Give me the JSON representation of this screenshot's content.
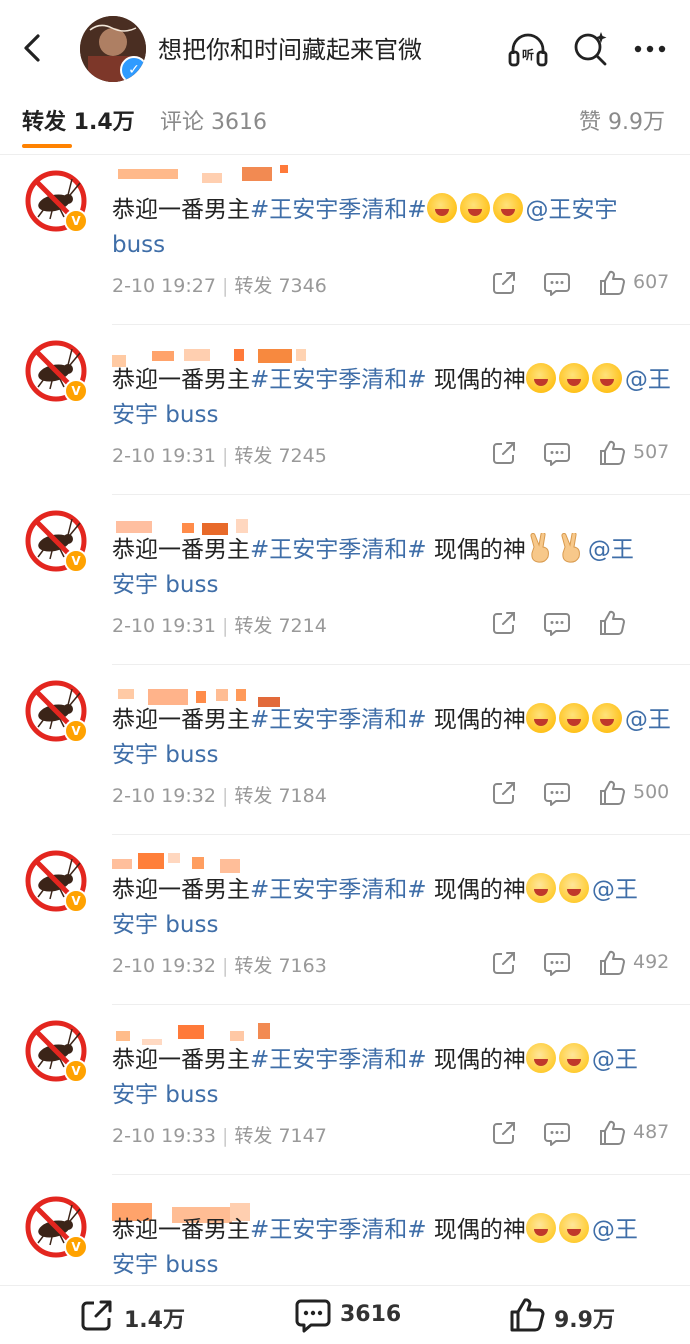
{
  "header": {
    "account_name": "想把你和时间藏起来官微"
  },
  "tabs": {
    "repost": "转发 1.4万",
    "comment": "评论 3616",
    "like": "赞 9.9万"
  },
  "reposts": [
    {
      "tag": "#王安宇季清和#",
      "prefix": "恭迎一番男主",
      "after": "",
      "emoji": [
        "cry-smile",
        "cry-smile",
        "cry-smile"
      ],
      "mention": "@王安宇",
      "mention2": "buss",
      "time": "2-10 19:27",
      "repost_label": "转发 7346",
      "likes": "607"
    },
    {
      "tag": "#王安宇季清和#",
      "prefix": "恭迎一番男主",
      "after": " 现偶的神",
      "emoji": [
        "cry-smile",
        "cry-smile",
        "cry-smile"
      ],
      "mention": "@王安宇 buss",
      "mention2": "",
      "time": "2-10 19:31",
      "repost_label": "转发 7245",
      "likes": "507"
    },
    {
      "tag": "#王安宇季清和#",
      "prefix": "恭迎一番男主",
      "after": " 现偶的神",
      "emoji": [
        "victory",
        "victory"
      ],
      "mention": "@王",
      "mention2": "安宇 buss",
      "time": "2-10 19:31",
      "repost_label": "转发 7214",
      "likes": ""
    },
    {
      "tag": "#王安宇季清和#",
      "prefix": "恭迎一番男主",
      "after": " 现偶的神",
      "emoji": [
        "cry-smile",
        "cry-smile",
        "cry-smile"
      ],
      "mention": "@王安宇 buss",
      "mention2": "",
      "time": "2-10 19:32",
      "repost_label": "转发 7184",
      "likes": "500"
    },
    {
      "tag": "#王安宇季清和#",
      "prefix": "恭迎一番男主",
      "after": " 现偶的神",
      "emoji": [
        "love",
        "love"
      ],
      "mention": "@王",
      "mention2": "安宇 buss",
      "time": "2-10 19:32",
      "repost_label": "转发 7163",
      "likes": "492"
    },
    {
      "tag": "#王安宇季清和#",
      "prefix": "恭迎一番男主",
      "after": " 现偶的神",
      "emoji": [
        "love",
        "love"
      ],
      "mention": "@王",
      "mention2": "安宇 buss",
      "time": "2-10 19:33",
      "repost_label": "转发 7147",
      "likes": "487"
    },
    {
      "tag": "#王安宇季清和#",
      "prefix": "恭迎一番男主",
      "after": " 现偶的神",
      "emoji": [
        "love",
        "love"
      ],
      "mention": "@王",
      "mention2": "安宇 buss",
      "time": "",
      "repost_label": "",
      "likes": ""
    }
  ],
  "bottom_bar": {
    "repost": "1.4万",
    "comment": "3616",
    "like": "9.9万"
  },
  "colors": {
    "accent": "#ff8200",
    "link": "#3f6ea8",
    "muted": "#999999"
  }
}
